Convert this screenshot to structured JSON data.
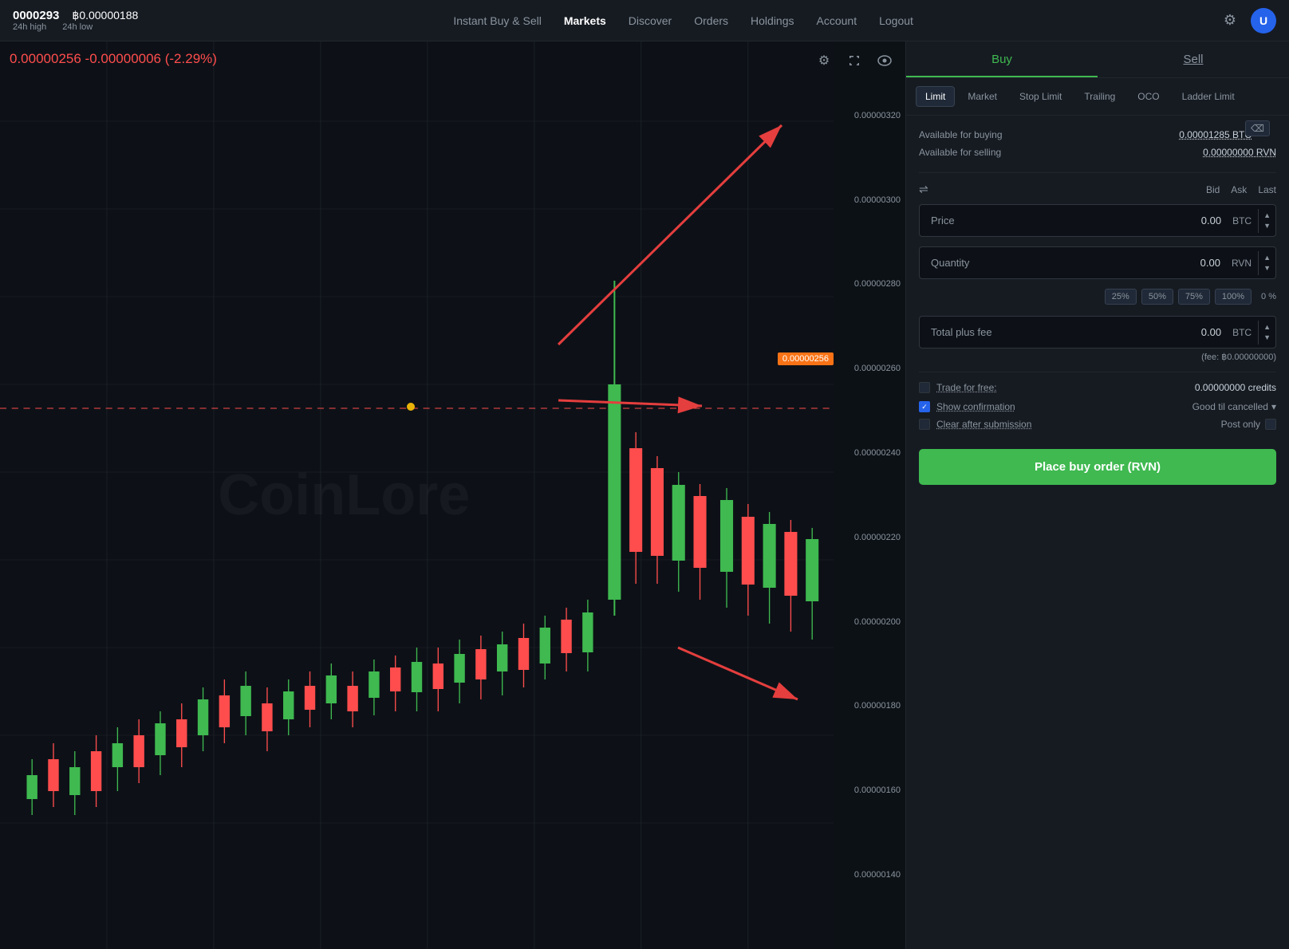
{
  "topnav": {
    "ticker": "0000293",
    "btc_price": "฿0.00000188",
    "high_label": "24h high",
    "low_label": "24h low",
    "nav_links": [
      {
        "label": "Instant Buy & Sell",
        "active": false
      },
      {
        "label": "Markets",
        "active": true
      },
      {
        "label": "Discover",
        "active": false
      },
      {
        "label": "Orders",
        "active": false
      },
      {
        "label": "Holdings",
        "active": false
      },
      {
        "label": "Account",
        "active": false
      },
      {
        "label": "Logout",
        "active": false
      }
    ]
  },
  "chart": {
    "current_price": "0.00000256",
    "price_change": "-0.00000006 (-2.29%)",
    "price_display": "0.00000256  -0.00000006 (-2.29%)",
    "watermark": "CoinLore",
    "current_price_badge": "0.00000256",
    "y_axis_labels": [
      "0.00000320",
      "0.00000300",
      "0.00000280",
      "0.00000260",
      "0.00000240",
      "0.00000220",
      "0.00000200",
      "0.00000180",
      "0.00000160",
      "0.00000140"
    ]
  },
  "right_panel": {
    "buy_label": "Buy",
    "sell_label": "Sell",
    "order_types": [
      "Limit",
      "Market",
      "Stop Limit",
      "Trailing",
      "OCO",
      "Ladder Limit"
    ],
    "active_order_type": "Limit",
    "available_buying_label": "Available for buying",
    "available_buying_value": "0.00001285 BTC",
    "available_selling_label": "Available for selling",
    "available_selling_value": "0.00000000 RVN",
    "bid_label": "Bid",
    "ask_label": "Ask",
    "last_label": "Last",
    "price_label": "Price",
    "price_value": "0.00",
    "price_currency": "BTC",
    "quantity_label": "Quantity",
    "quantity_value": "0.00",
    "quantity_currency": "RVN",
    "pct_buttons": [
      "25%",
      "50%",
      "75%",
      "100%"
    ],
    "pct_display": "0 %",
    "total_label": "Total plus fee",
    "total_value": "0.00",
    "total_currency": "BTC",
    "fee_note": "(fee: ฿0.00000000)",
    "trade_free_label": "Trade for free:",
    "credits_value": "0.00000000 credits",
    "show_confirmation_label": "Show confirmation",
    "gtc_label": "Good til cancelled",
    "clear_submission_label": "Clear after submission",
    "post_only_label": "Post only",
    "place_order_label": "Place buy order (RVN)"
  }
}
